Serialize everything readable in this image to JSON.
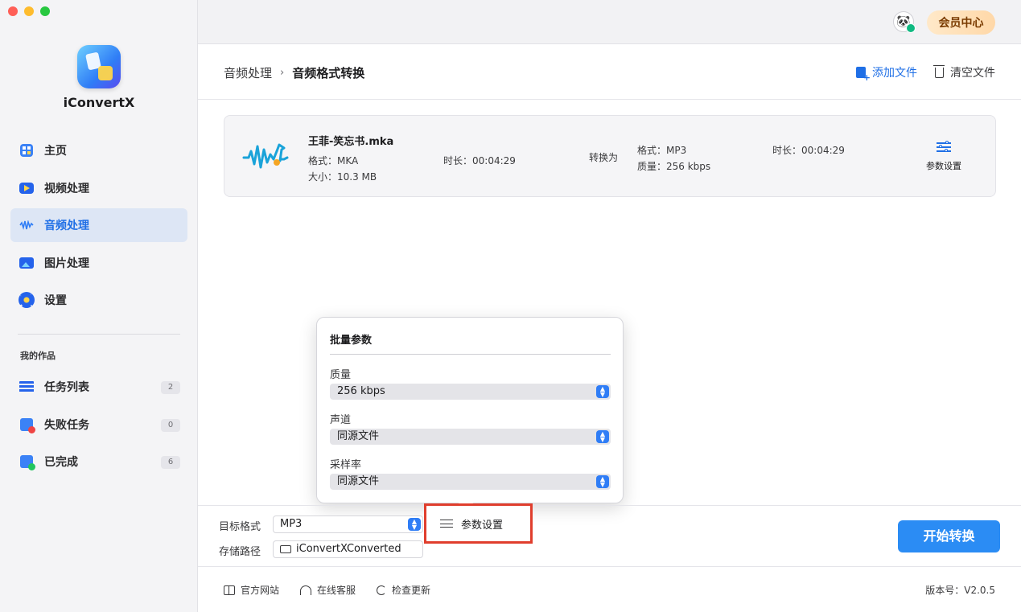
{
  "app": {
    "name": "iConvertX"
  },
  "sidebar": {
    "items": [
      {
        "label": "主页",
        "icon": "home-icon",
        "active": false
      },
      {
        "label": "视频处理",
        "icon": "video-icon",
        "active": false
      },
      {
        "label": "音频处理",
        "icon": "audio-wave-icon",
        "active": true
      },
      {
        "label": "图片处理",
        "icon": "image-icon",
        "active": false
      },
      {
        "label": "设置",
        "icon": "gear-icon",
        "active": false
      }
    ],
    "section_label": "我的作品",
    "works": [
      {
        "label": "任务列表",
        "count": "2",
        "icon": "list-icon"
      },
      {
        "label": "失败任务",
        "count": "0",
        "icon": "failed-icon"
      },
      {
        "label": "已完成",
        "count": "6",
        "icon": "completed-icon"
      }
    ]
  },
  "topbar": {
    "vip_label": "会员中心"
  },
  "header": {
    "breadcrumb_parent": "音频处理",
    "breadcrumb_sep": "›",
    "breadcrumb_current": "音频格式转换",
    "add_file": "添加文件",
    "clear_files": "清空文件"
  },
  "file": {
    "name": "王菲-笑忘书.mka",
    "format": "格式：MKA",
    "size": "大小：10.3 MB",
    "duration": "时长：00:04:29",
    "convert_to": "转换为",
    "out_format": "格式：MP3",
    "out_quality": "质量：256 kbps",
    "out_duration": "时长：00:04:29",
    "param_label": "参数设置"
  },
  "popover": {
    "title": "批量参数",
    "quality_label": "质量",
    "quality_value": "256 kbps",
    "channel_label": "声道",
    "channel_value": "同源文件",
    "samplerate_label": "采样率",
    "samplerate_value": "同源文件"
  },
  "bottom": {
    "target_format_label": "目标格式",
    "target_format_value": "MP3",
    "save_path_label": "存储路径",
    "save_path_value": "iConvertXConverted",
    "param_button": "参数设置",
    "start_button": "开始转换"
  },
  "footer": {
    "website": "官方网站",
    "support": "在线客服",
    "update": "检查更新",
    "version": "版本号：V2.0.5"
  },
  "colors": {
    "accent": "#2b8cf4",
    "highlight_border": "#e03e2d",
    "vip_bg": "#ffd8a8"
  }
}
